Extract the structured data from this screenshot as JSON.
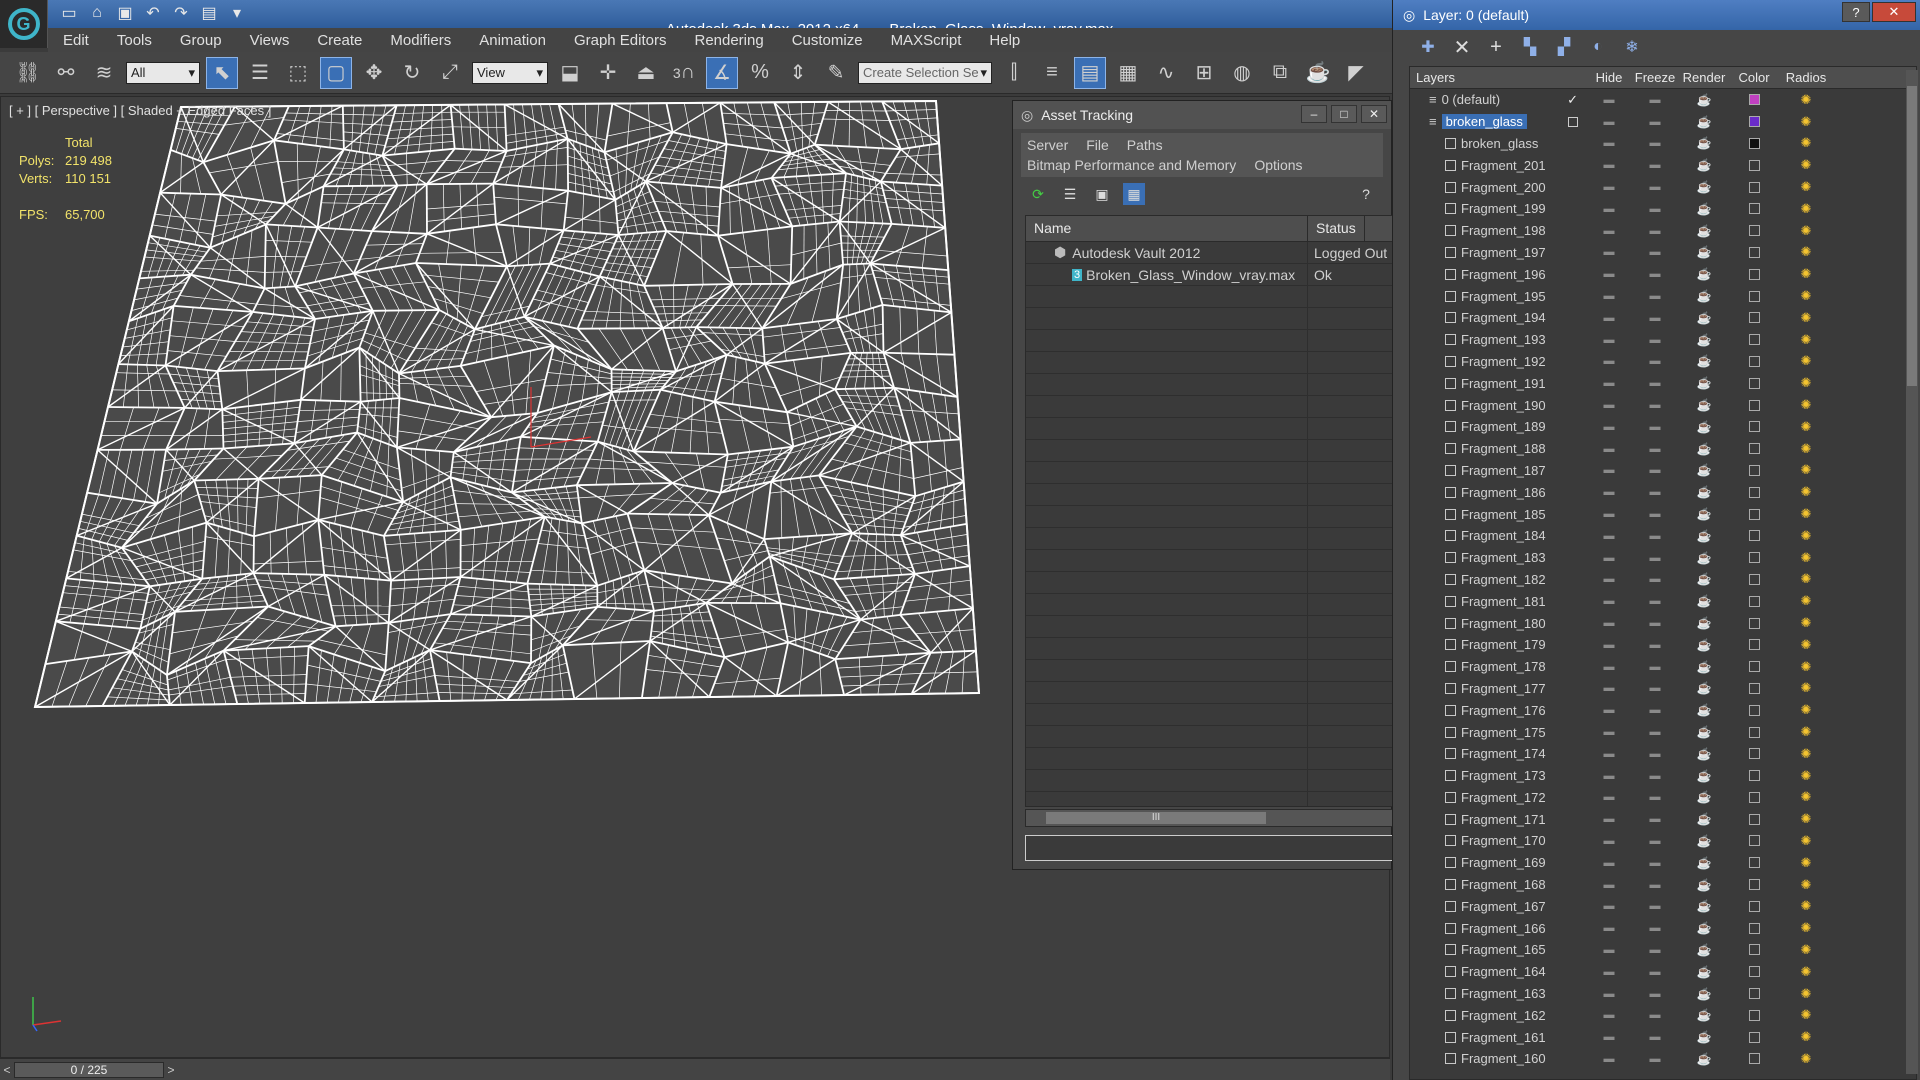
{
  "title_bar": {
    "app_name": "Autodesk 3ds Max  2012 x64",
    "file_name": "Broken_Glass_Window_vray.max"
  },
  "menu": [
    "Edit",
    "Tools",
    "Group",
    "Views",
    "Create",
    "Modifiers",
    "Animation",
    "Graph Editors",
    "Rendering",
    "Customize",
    "MAXScript",
    "Help"
  ],
  "toolbar": {
    "filter_value": "All",
    "reference_coord": "View",
    "snap_number": "3",
    "selection_set_placeholder": "Create Selection Se"
  },
  "viewport": {
    "label": "[ + ] [ Perspective ] [ Shaded + Edged Faces ]",
    "stats": {
      "total_label": "Total",
      "polys_label": "Polys:",
      "polys_value": "219 498",
      "verts_label": "Verts:",
      "verts_value": "110 151",
      "fps_label": "FPS:",
      "fps_value": "65,700"
    }
  },
  "time_slider": {
    "value": "0 / 225",
    "prev": "<",
    "next": ">"
  },
  "asset_tracking": {
    "title": "Asset Tracking",
    "menu": [
      "Server",
      "File",
      "Paths",
      "Bitmap Performance and Memory",
      "Options"
    ],
    "columns": [
      "Name",
      "Status"
    ],
    "rows": [
      {
        "name": "Autodesk Vault 2012",
        "status": "Logged Out"
      },
      {
        "name": "Broken_Glass_Window_vray.max",
        "status": "Ok"
      }
    ],
    "scroll_label": "III"
  },
  "layer_manager": {
    "title": "Layer: 0 (default)",
    "columns": [
      "Layers",
      "Hide",
      "Freeze",
      "Render",
      "Color",
      "Radios"
    ],
    "layers": [
      {
        "name": "0 (default)",
        "type": "layer",
        "color": "#c040c0",
        "check": "✓"
      },
      {
        "name": "broken_glass",
        "type": "layer",
        "color": "#6a2bc8",
        "selected": true
      },
      {
        "name": "broken_glass",
        "type": "object",
        "color": "#111111"
      },
      {
        "name": "Fragment_201",
        "type": "object"
      },
      {
        "name": "Fragment_200",
        "type": "object"
      },
      {
        "name": "Fragment_199",
        "type": "object"
      },
      {
        "name": "Fragment_198",
        "type": "object"
      },
      {
        "name": "Fragment_197",
        "type": "object"
      },
      {
        "name": "Fragment_196",
        "type": "object"
      },
      {
        "name": "Fragment_195",
        "type": "object"
      },
      {
        "name": "Fragment_194",
        "type": "object"
      },
      {
        "name": "Fragment_193",
        "type": "object"
      },
      {
        "name": "Fragment_192",
        "type": "object"
      },
      {
        "name": "Fragment_191",
        "type": "object"
      },
      {
        "name": "Fragment_190",
        "type": "object"
      },
      {
        "name": "Fragment_189",
        "type": "object"
      },
      {
        "name": "Fragment_188",
        "type": "object"
      },
      {
        "name": "Fragment_187",
        "type": "object"
      },
      {
        "name": "Fragment_186",
        "type": "object"
      },
      {
        "name": "Fragment_185",
        "type": "object"
      },
      {
        "name": "Fragment_184",
        "type": "object"
      },
      {
        "name": "Fragment_183",
        "type": "object"
      },
      {
        "name": "Fragment_182",
        "type": "object"
      },
      {
        "name": "Fragment_181",
        "type": "object"
      },
      {
        "name": "Fragment_180",
        "type": "object"
      },
      {
        "name": "Fragment_179",
        "type": "object"
      },
      {
        "name": "Fragment_178",
        "type": "object"
      },
      {
        "name": "Fragment_177",
        "type": "object"
      },
      {
        "name": "Fragment_176",
        "type": "object"
      },
      {
        "name": "Fragment_175",
        "type": "object"
      },
      {
        "name": "Fragment_174",
        "type": "object"
      },
      {
        "name": "Fragment_173",
        "type": "object"
      },
      {
        "name": "Fragment_172",
        "type": "object"
      },
      {
        "name": "Fragment_171",
        "type": "object"
      },
      {
        "name": "Fragment_170",
        "type": "object"
      },
      {
        "name": "Fragment_169",
        "type": "object"
      },
      {
        "name": "Fragment_168",
        "type": "object"
      },
      {
        "name": "Fragment_167",
        "type": "object"
      },
      {
        "name": "Fragment_166",
        "type": "object"
      },
      {
        "name": "Fragment_165",
        "type": "object"
      },
      {
        "name": "Fragment_164",
        "type": "object"
      },
      {
        "name": "Fragment_163",
        "type": "object"
      },
      {
        "name": "Fragment_162",
        "type": "object"
      },
      {
        "name": "Fragment_161",
        "type": "object"
      },
      {
        "name": "Fragment_160",
        "type": "object"
      }
    ]
  },
  "colors": {
    "accent": "#3a6fb5",
    "title_bar": "#2f5d9b",
    "stats_text": "#f2e36a",
    "wireframe": "#ffffff"
  }
}
